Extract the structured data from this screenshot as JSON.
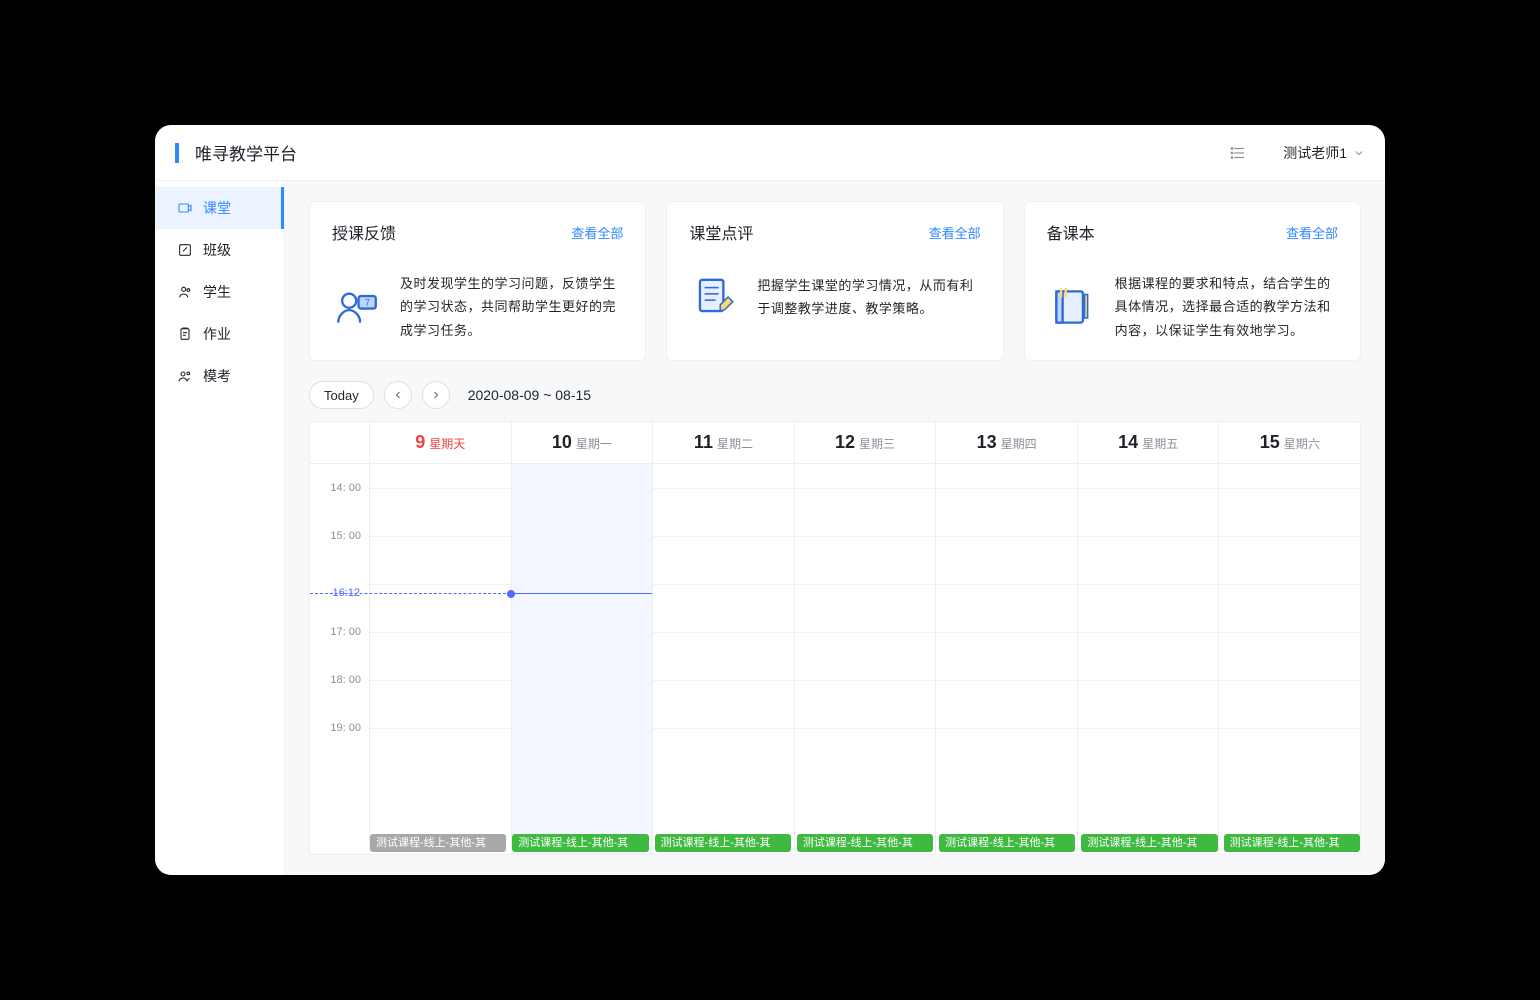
{
  "header": {
    "title": "唯寻教学平台",
    "user": "测试老师1"
  },
  "sidebar": {
    "items": [
      {
        "label": "课堂",
        "active": true
      },
      {
        "label": "班级",
        "active": false
      },
      {
        "label": "学生",
        "active": false
      },
      {
        "label": "作业",
        "active": false
      },
      {
        "label": "模考",
        "active": false
      }
    ]
  },
  "cards": {
    "view_all": "查看全部",
    "items": [
      {
        "title": "授课反馈",
        "desc": "及时发现学生的学习问题，反馈学生的学习状态，共同帮助学生更好的完成学习任务。"
      },
      {
        "title": "课堂点评",
        "desc": "把握学生课堂的学习情况，从而有利于调整教学进度、教学策略。"
      },
      {
        "title": "备课本",
        "desc": "根据课程的要求和特点，结合学生的具体情况，选择最合适的教学方法和内容，以保证学生有效地学习。"
      }
    ]
  },
  "calendar": {
    "today_label": "Today",
    "range": "2020-08-09 ~ 08-15",
    "now": "16:12",
    "days": [
      {
        "num": "9",
        "label": "星期天",
        "is_today": true,
        "is_current": false
      },
      {
        "num": "10",
        "label": "星期一",
        "is_today": false,
        "is_current": true
      },
      {
        "num": "11",
        "label": "星期二",
        "is_today": false,
        "is_current": false
      },
      {
        "num": "12",
        "label": "星期三",
        "is_today": false,
        "is_current": false
      },
      {
        "num": "13",
        "label": "星期四",
        "is_today": false,
        "is_current": false
      },
      {
        "num": "14",
        "label": "星期五",
        "is_today": false,
        "is_current": false
      },
      {
        "num": "15",
        "label": "星期六",
        "is_today": false,
        "is_current": false
      }
    ],
    "hours": [
      "14: 00",
      "15: 00",
      "17: 00",
      "18: 00",
      "19: 00"
    ],
    "hour_slots": [
      14,
      15,
      16,
      17,
      18,
      19
    ],
    "allday": [
      {
        "text": "测试课程-线上-其他-其",
        "color": "gray"
      },
      {
        "text": "测试课程-线上-其他-其",
        "color": "green"
      },
      {
        "text": "测试课程-线上-其他-其",
        "color": "green"
      },
      {
        "text": "测试课程-线上-其他-其",
        "color": "green"
      },
      {
        "text": "测试课程-线上-其他-其",
        "color": "green"
      },
      {
        "text": "测试课程-线上-其他-其",
        "color": "green"
      },
      {
        "text": "测试课程-线上-其他-其",
        "color": "green"
      }
    ]
  }
}
